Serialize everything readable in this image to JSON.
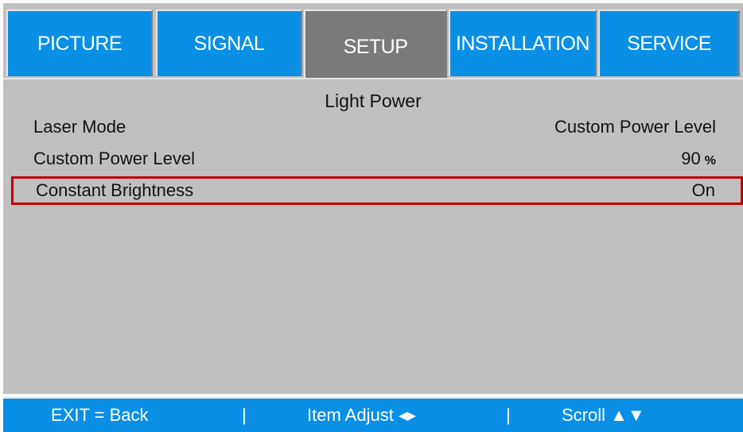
{
  "tabs": [
    {
      "label": "PICTURE"
    },
    {
      "label": "SIGNAL"
    },
    {
      "label": "SETUP"
    },
    {
      "label": "INSTALLATION"
    },
    {
      "label": "SERVICE"
    }
  ],
  "active_tab": "SETUP",
  "panel": {
    "title": "Light Power",
    "rows": [
      {
        "label": "Laser Mode",
        "value": "Custom Power Level",
        "unit": ""
      },
      {
        "label": "Custom Power Level",
        "value": "90",
        "unit": "%"
      },
      {
        "label": "Constant Brightness",
        "value": "On",
        "unit": ""
      }
    ],
    "selected_row": "Constant Brightness"
  },
  "footer": {
    "exit": "EXIT = Back",
    "sep": "|",
    "adjust": "Item Adjust ◂▸",
    "scroll": "Scroll ▲▼"
  },
  "colors": {
    "tab_blue": "#0a8fe6",
    "tab_active": "#7a7a7a",
    "panel_gray": "#c0c0c0",
    "selection_red": "#c00000"
  }
}
